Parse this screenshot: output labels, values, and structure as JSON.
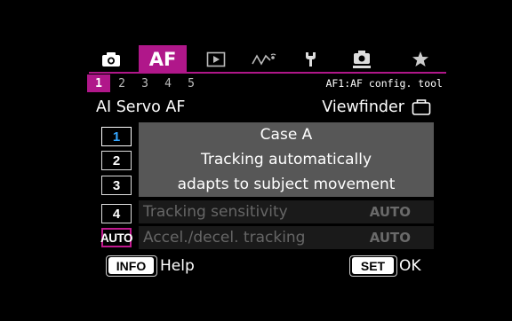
{
  "tabs": [
    {
      "id": "shooting",
      "icon": "camera-icon"
    },
    {
      "id": "af",
      "label": "AF",
      "active": true
    },
    {
      "id": "playback",
      "icon": "play-icon"
    },
    {
      "id": "wireless",
      "icon": "wireless-icon"
    },
    {
      "id": "setup",
      "icon": "wrench-icon"
    },
    {
      "id": "custom",
      "icon": "custom-function-icon"
    },
    {
      "id": "mymenu",
      "icon": "star-icon"
    }
  ],
  "pages": [
    "1",
    "2",
    "3",
    "4",
    "5"
  ],
  "active_page": "1",
  "menu_name": "AF1:AF config. tool",
  "header": {
    "left": "AI Servo AF",
    "right": "Viewfinder"
  },
  "cases": [
    {
      "label": "1",
      "selected": true
    },
    {
      "label": "2"
    },
    {
      "label": "3"
    },
    {
      "label": "4"
    },
    {
      "label": "AUTO"
    }
  ],
  "description": {
    "title": "Case A",
    "line1": "Tracking automatically",
    "line2": "adapts to subject movement"
  },
  "params": [
    {
      "label": "Tracking sensitivity",
      "value": "AUTO"
    },
    {
      "label": "Accel./decel. tracking",
      "value": "AUTO"
    }
  ],
  "footer": {
    "info_key": "INFO",
    "info_label": "Help",
    "set_key": "SET",
    "set_label": "OK"
  },
  "colors": {
    "accent": "#b0178a",
    "selected_case": "#35a6ff",
    "panel": "#575757"
  }
}
